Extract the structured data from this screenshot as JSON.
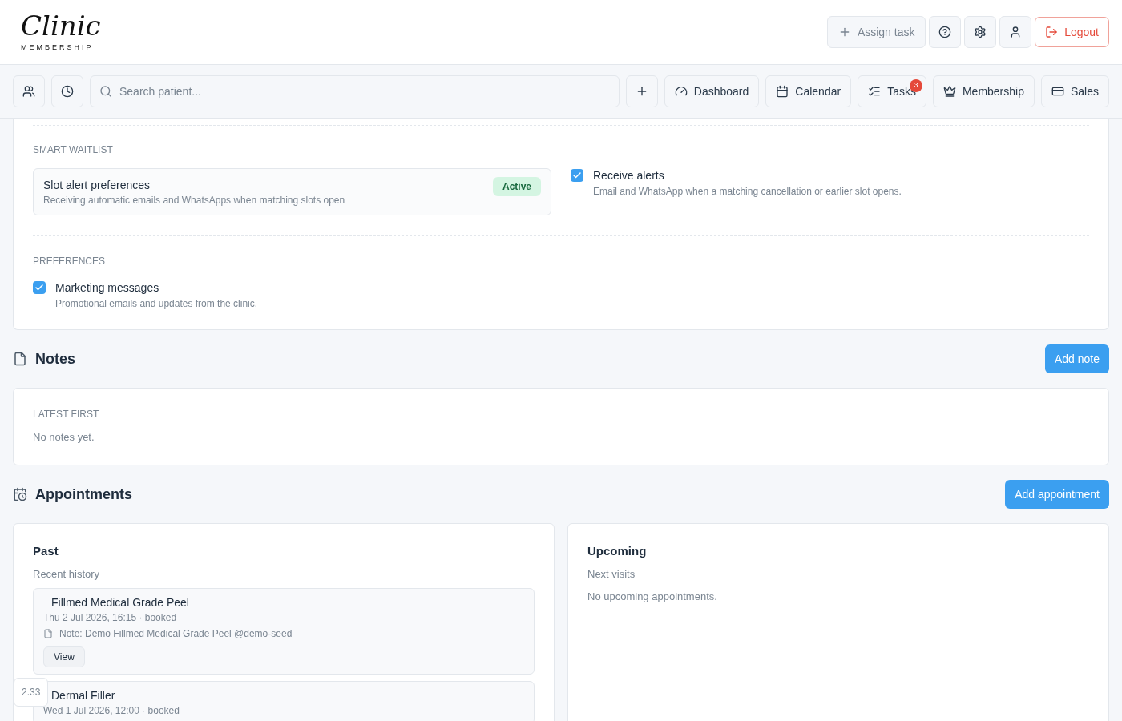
{
  "logo": {
    "script": "Clinic",
    "subtitle": "MEMBERSHIP"
  },
  "header_actions": {
    "assign_task": "Assign task",
    "logout": "Logout"
  },
  "toolbar": {
    "search": {
      "placeholder": "Search patient..."
    },
    "nav": [
      {
        "kind": "dashboard",
        "label": "Dashboard"
      },
      {
        "kind": "calendar",
        "label": "Calendar"
      },
      {
        "kind": "tasks",
        "label": "Tasks",
        "badge": "3"
      },
      {
        "kind": "membership",
        "label": "Membership"
      },
      {
        "kind": "sales",
        "label": "Sales"
      }
    ]
  },
  "smart_waitlist": {
    "heading": "SMART WAITLIST",
    "card": {
      "title": "Slot alert preferences",
      "description": "Receiving automatic emails and WhatsApps when matching slots open",
      "status": "Active"
    },
    "option": {
      "label": "Receive alerts",
      "description": "Email and WhatsApp when a matching cancellation or earlier slot opens.",
      "checked": true
    }
  },
  "preferences": {
    "heading": "PREFERENCES",
    "options": [
      {
        "label": "Marketing messages",
        "description": "Promotional emails and updates from the clinic.",
        "checked": true
      }
    ]
  },
  "notes": {
    "title": "Notes",
    "button": "Add note",
    "heading": "LATEST FIRST",
    "empty": "No notes yet."
  },
  "appointments": {
    "title": "Appointments",
    "button": "Add appointment",
    "past": {
      "title": "Past",
      "subtitle": "Recent history",
      "items": [
        {
          "name": "Fillmed Medical Grade Peel",
          "when": "Thu 2 Jul 2026, 16:15 · booked",
          "note": "Note: Demo Fillmed Medical Grade Peel @demo-seed",
          "button": "View"
        },
        {
          "name": "Dermal Filler",
          "when": "Wed 1 Jul 2026, 12:00 · booked"
        }
      ]
    },
    "upcoming": {
      "title": "Upcoming",
      "subtitle": "Next visits",
      "empty": "No upcoming appointments."
    }
  },
  "version_badge": "2.33"
}
